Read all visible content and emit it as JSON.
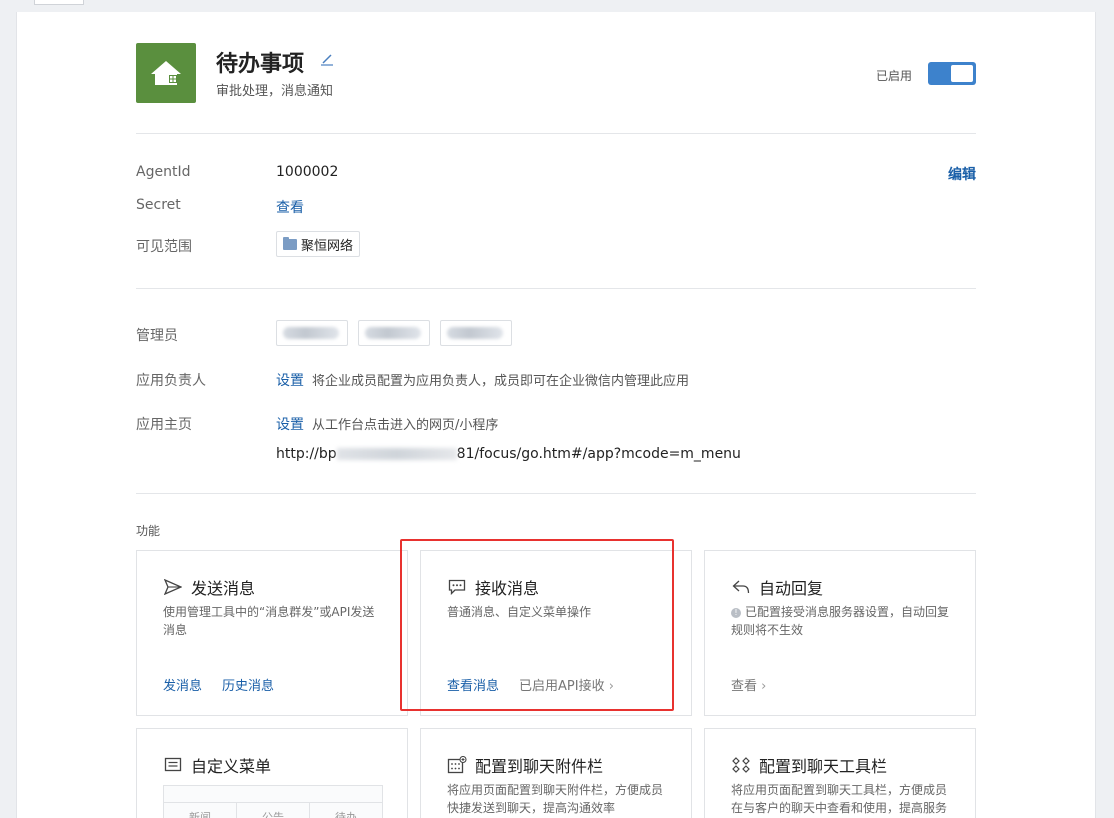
{
  "app": {
    "name": "待办事项",
    "description": "审批处理，消息通知",
    "status_label": "已启用",
    "enabled": true
  },
  "info": {
    "agentid_label": "AgentId",
    "agentid_value": "1000002",
    "edit_label": "编辑",
    "secret_label": "Secret",
    "secret_link": "查看",
    "scope_label": "可见范围",
    "scope_value": "聚恒网络"
  },
  "admin": {
    "admins_label": "管理员",
    "owner_label": "应用负责人",
    "owner_link": "设置",
    "owner_desc": "将企业成员配置为应用负责人，成员即可在企业微信内管理此应用",
    "home_label": "应用主页",
    "home_link": "设置",
    "home_desc": "从工作台点击进入的网页/小程序",
    "home_url_prefix": "http://bp",
    "home_url_suffix": "81/focus/go.htm#/app?mcode=m_menu"
  },
  "features": {
    "section_title": "功能",
    "send": {
      "title": "发送消息",
      "desc": "使用管理工具中的“消息群发”或API发送消息",
      "action1": "发消息",
      "action2": "历史消息"
    },
    "receive": {
      "title": "接收消息",
      "desc": "普通消息、自定义菜单操作",
      "action1": "查看消息",
      "status": "已启用API接收"
    },
    "auto_reply": {
      "title": "自动回复",
      "desc": "已配置接受消息服务器设置，自动回复规则将不生效",
      "action": "查看"
    },
    "custom_menu": {
      "title": "自定义菜单",
      "menu_items": [
        "新闻",
        "公告",
        "待办"
      ]
    },
    "chat_attach": {
      "title": "配置到聊天附件栏",
      "desc": "将应用页面配置到聊天附件栏，方便成员快捷发送到聊天，提高沟通效率"
    },
    "chat_toolbar": {
      "title": "配置到聊天工具栏",
      "desc": "将应用页面配置到聊天工具栏，方便成员在与客户的聊天中查看和使用，提高服务"
    }
  },
  "colors": {
    "accent": "#3d82cc",
    "link": "#1a5fa8",
    "app_icon": "#5a8f3e",
    "highlight": "#e8322f"
  }
}
